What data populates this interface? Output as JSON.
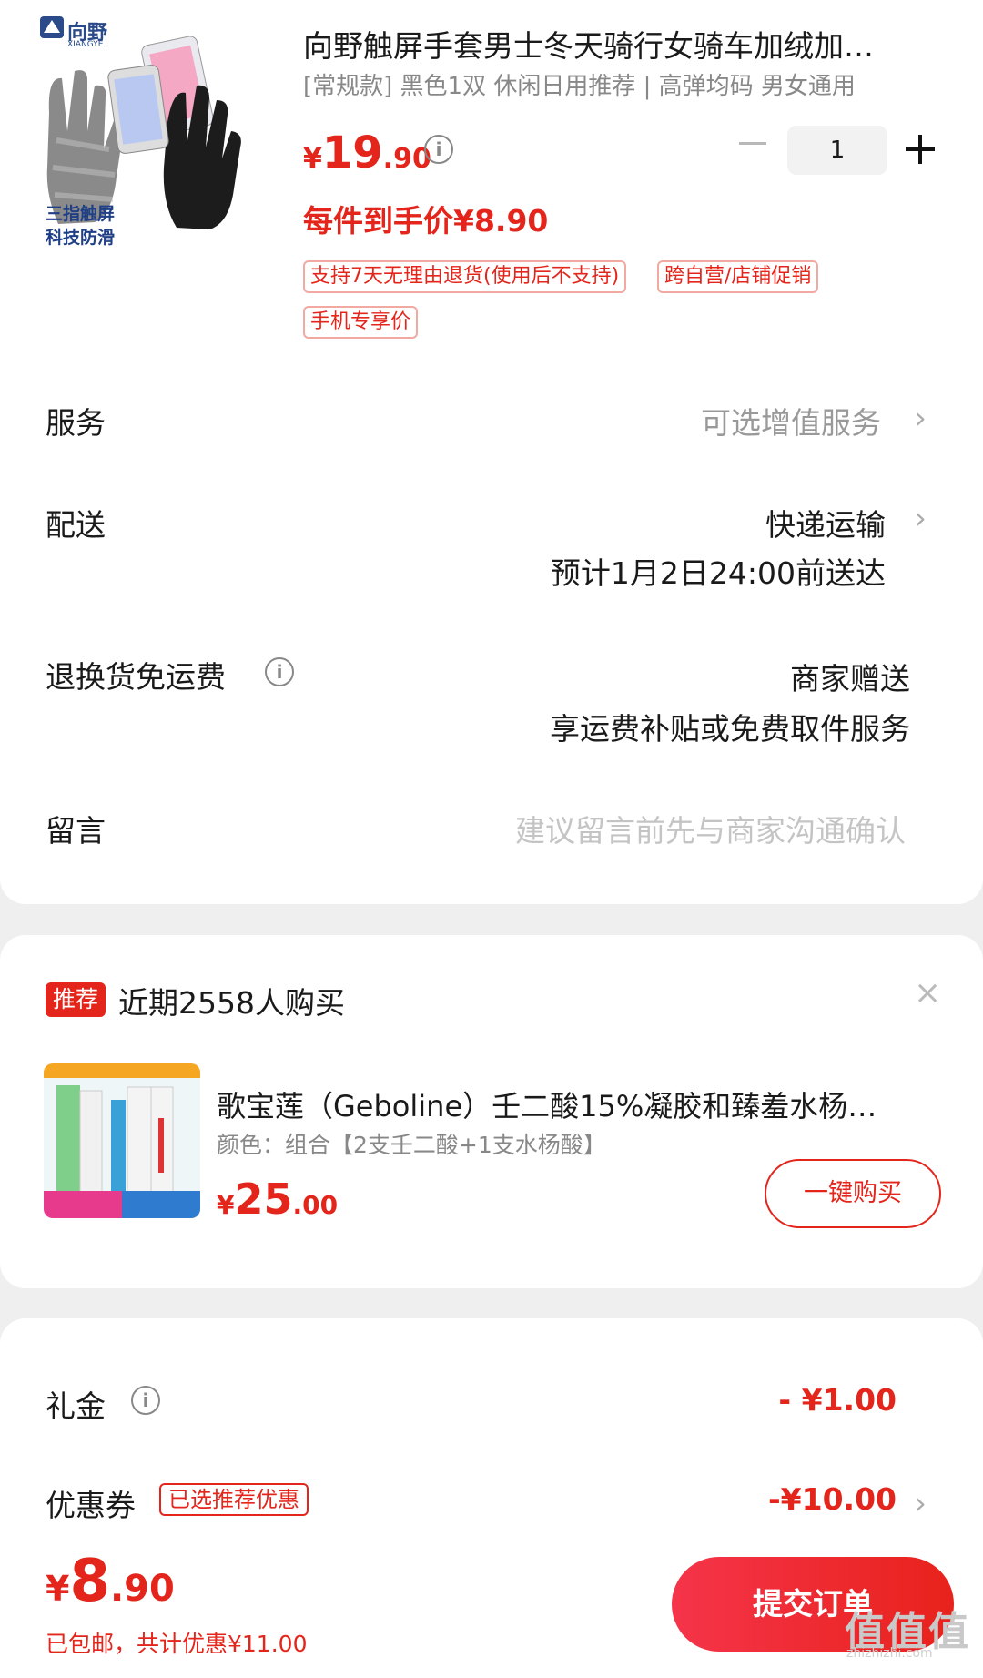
{
  "product": {
    "image_brand": "向野",
    "image_brand_en": "XIANGYE",
    "image_caption": [
      "三指触屏",
      "科技防滑"
    ],
    "title": "向野触屏手套男士冬天骑行女骑车加绒加…",
    "spec": "[常规款] 黑色1双 休闲日用推荐 | 高弹均码 男女通用",
    "price_symbol": "¥",
    "price_int": "19",
    "price_dec": ".90",
    "quantity": "1",
    "net_price": "每件到手价¥8.90",
    "tags": [
      "支持7天无理由退货(使用后不支持)",
      "跨自营/店铺促销",
      "手机专享价"
    ]
  },
  "rows": {
    "service": {
      "label": "服务",
      "value": "可选增值服务"
    },
    "delivery": {
      "label": "配送",
      "value": "快递运输",
      "eta": "预计1月2日24:00前送达"
    },
    "return": {
      "label": "退换货免运费",
      "value": "商家赠送",
      "sub": "享运费补贴或免费取件服务"
    },
    "message": {
      "label": "留言",
      "placeholder": "建议留言前先与商家沟通确认"
    }
  },
  "recommend": {
    "badge": "推荐",
    "text": "近期2558人购买",
    "close": "×",
    "title": "歌宝莲（Geboline）壬二酸15%凝胶和臻羞水杨…",
    "spec": "颜色：组合【2支壬二酸+1支水杨酸】",
    "price_symbol": "¥",
    "price_int": "25",
    "price_dec": ".00",
    "buy_label": "一键购买"
  },
  "discounts": {
    "gift": {
      "label": "礼金",
      "value": "- ¥1.00"
    },
    "coupon": {
      "label": "优惠券",
      "tag": "已选推荐优惠",
      "value": "-¥10.00"
    }
  },
  "footer": {
    "total_symbol": "¥",
    "total_int": "8",
    "total_dec": ".90",
    "sub": "已包邮，共计优惠¥11.00",
    "submit": "提交订单",
    "watermark": "值值值",
    "watermark_url": "zhizhizhi.com"
  },
  "colors": {
    "accent": "#e4251b"
  }
}
